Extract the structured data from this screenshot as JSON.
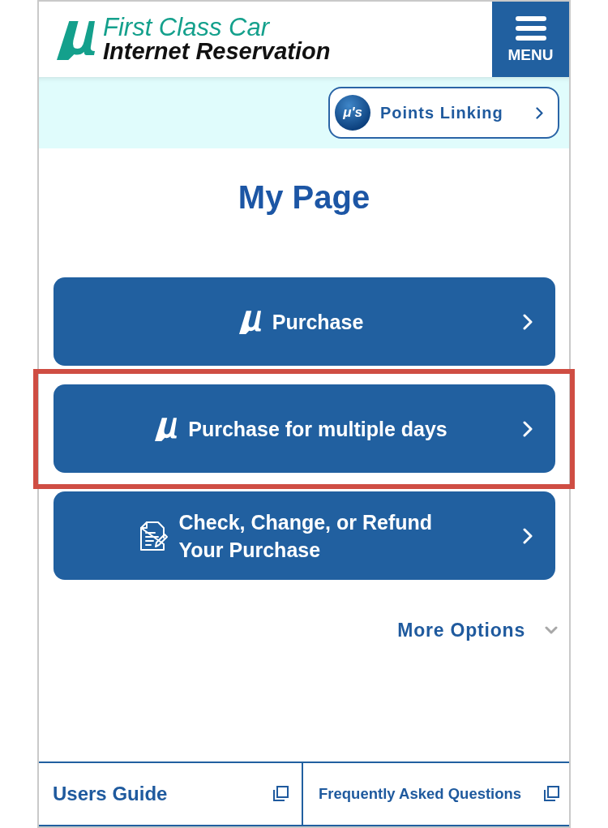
{
  "header": {
    "logo": {
      "line_1": "First Class Car",
      "line_2": "Internet Reservation"
    },
    "menu_button": {
      "label": "MENU"
    }
  },
  "points_bar": {
    "logo_text": "μ's",
    "label": "Points Linking"
  },
  "page_title": "My Page",
  "menu_items": [
    {
      "kind": "mu",
      "label": "Purchase",
      "highlighted": false
    },
    {
      "kind": "mu",
      "label": "Purchase for multiple days",
      "highlighted": true
    },
    {
      "kind": "document",
      "label": "Check, Change, or Refund Your Purchase",
      "highlighted": false
    }
  ],
  "more_options": {
    "label": "More Options",
    "expanded": false
  },
  "footer_links": [
    {
      "label": "Users Guide"
    },
    {
      "label": "Frequently Asked Questions"
    }
  ]
}
